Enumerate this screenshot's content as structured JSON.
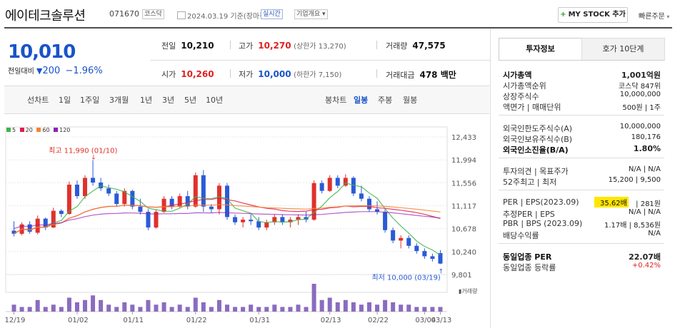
{
  "header": {
    "company": "에이테크솔루션",
    "code": "071670",
    "market_tag": "코스닥",
    "date_text": "2024.03.19 기준(장마감)",
    "realtime_tag": "실시간",
    "info_tag": "기업개요 ▾",
    "mystock_button": "MY STOCK 추가",
    "quick_order": "빠른주문"
  },
  "price": {
    "current": "10,010",
    "change_label": "전일대비",
    "change_value": "200",
    "change_pct": "−1.96%"
  },
  "stats": {
    "prev_label": "전일",
    "prev": "10,210",
    "high_label": "고가",
    "high": "10,270",
    "upper_limit": "(상한가 13,270)",
    "volume_label": "거래량",
    "volume": "47,575",
    "open_label": "시가",
    "open": "10,260",
    "low_label": "저가",
    "low": "10,000",
    "lower_limit": "(하한가 7,150)",
    "amount_label": "거래대금",
    "amount": "478 백만"
  },
  "range_tabs": {
    "line_chart": "선차트",
    "items": [
      "1일",
      "1주일",
      "3개월",
      "1년",
      "3년",
      "5년",
      "10년"
    ],
    "candle_chart": "봉차트",
    "periods": [
      "일봉",
      "주봉",
      "월봉"
    ],
    "selected_period": "일봉"
  },
  "chart_data": {
    "type": "candlestick",
    "legend": [
      {
        "label": "5",
        "color": "#3cb44b"
      },
      {
        "label": "20",
        "color": "#e6194b"
      },
      {
        "label": "60",
        "color": "#f58231"
      },
      {
        "label": "120",
        "color": "#911eb4"
      }
    ],
    "y_ticks": [
      "12,433",
      "11,994",
      "11,556",
      "11,117",
      "10,678",
      "10,240",
      "9,801"
    ],
    "ylim": [
      9801,
      12433
    ],
    "x_ticks": [
      "12/19",
      "01/02",
      "01/11",
      "01/22",
      "01/31",
      "02/13",
      "02/22",
      "03/04",
      "03/13"
    ],
    "annotations": {
      "high": "최고 11,990 (01/10)",
      "low": "최저 10,000 (03/19)"
    },
    "volume_label": "거래량",
    "candles": [
      [
        10640,
        10820,
        10530,
        10580
      ],
      [
        10580,
        10800,
        10550,
        10760
      ],
      [
        10760,
        10820,
        10580,
        10620
      ],
      [
        10600,
        10930,
        10570,
        10870
      ],
      [
        10870,
        10890,
        10650,
        10700
      ],
      [
        10700,
        11080,
        10690,
        11020
      ],
      [
        11020,
        11050,
        10900,
        10960
      ],
      [
        10960,
        11580,
        10940,
        11520
      ],
      [
        11520,
        11600,
        11250,
        11300
      ],
      [
        11300,
        11700,
        11250,
        11650
      ],
      [
        11650,
        11990,
        11500,
        11560
      ],
      [
        11560,
        11650,
        11400,
        11450
      ],
      [
        11450,
        11520,
        11300,
        11350
      ],
      [
        11350,
        11400,
        11100,
        11150
      ],
      [
        11150,
        11450,
        11100,
        11400
      ],
      [
        11400,
        11420,
        11050,
        11100
      ],
      [
        11100,
        11250,
        10950,
        11000
      ],
      [
        11000,
        11050,
        10650,
        10700
      ],
      [
        10700,
        11050,
        10680,
        11000
      ],
      [
        11000,
        11300,
        10980,
        11250
      ],
      [
        11250,
        11300,
        11050,
        11100
      ],
      [
        11100,
        11350,
        11080,
        11300
      ],
      [
        11300,
        11400,
        11050,
        11100
      ],
      [
        11100,
        11750,
        11080,
        11700
      ],
      [
        11700,
        11800,
        11000,
        11100
      ],
      [
        11100,
        11150,
        10980,
        11050
      ],
      [
        11050,
        11550,
        10950,
        11500
      ],
      [
        11500,
        11550,
        10850,
        10900
      ],
      [
        10900,
        10950,
        10750,
        10800
      ],
      [
        10800,
        10900,
        10700,
        10850
      ],
      [
        10850,
        10950,
        10750,
        10820
      ],
      [
        10820,
        10900,
        10650,
        10700
      ],
      [
        10700,
        10850,
        10650,
        10800
      ],
      [
        10800,
        10950,
        10750,
        10900
      ],
      [
        10900,
        10950,
        10750,
        10800
      ],
      [
        10800,
        10900,
        10700,
        10850
      ],
      [
        10850,
        10950,
        10750,
        10900
      ],
      [
        10900,
        11000,
        10800,
        10850
      ],
      [
        10850,
        11600,
        10830,
        11550
      ],
      [
        11550,
        11600,
        11350,
        11400
      ],
      [
        11400,
        11700,
        11380,
        11650
      ],
      [
        11650,
        11700,
        11450,
        11500
      ],
      [
        11500,
        11720,
        11480,
        11650
      ],
      [
        11650,
        11680,
        11300,
        11350
      ],
      [
        11350,
        11500,
        11200,
        11250
      ],
      [
        11250,
        11300,
        11000,
        11050
      ],
      [
        11050,
        11200,
        10950,
        11000
      ],
      [
        11000,
        11050,
        10600,
        10650
      ],
      [
        10650,
        10700,
        10400,
        10450
      ],
      [
        10450,
        10550,
        10300,
        10500
      ],
      [
        10500,
        10550,
        10300,
        10350
      ],
      [
        10350,
        10400,
        10200,
        10250
      ],
      [
        10250,
        10300,
        10100,
        10150
      ],
      [
        10150,
        10200,
        10050,
        10100
      ],
      [
        10210,
        10270,
        10000,
        10010
      ]
    ],
    "volumes": [
      3,
      2,
      2,
      5,
      2,
      3,
      2,
      6,
      4,
      5,
      7,
      5,
      3,
      2,
      4,
      3,
      2,
      5,
      3,
      4,
      2,
      3,
      2,
      6,
      4,
      2,
      5,
      3,
      2,
      2,
      3,
      2,
      2,
      3,
      2,
      2,
      3,
      2,
      12,
      5,
      6,
      4,
      5,
      4,
      3,
      4,
      3,
      5,
      4,
      3,
      3,
      2,
      2,
      2,
      2
    ]
  },
  "right_panel": {
    "tab_invest": "투자정보",
    "tab_quote": "호가 10단계",
    "rows1": [
      {
        "label": "시가총액",
        "value": "1,001억원",
        "bold": true
      },
      {
        "label": "시가총액순위",
        "value": "코스닥 847위"
      },
      {
        "label": "상장주식수",
        "value": "10,000,000"
      },
      {
        "label": "액면가 | 매매단위",
        "value": "500원 | 1주"
      }
    ],
    "rows2": [
      {
        "label": "외국인한도주식수(A)",
        "value": "10,000,000"
      },
      {
        "label": "외국인보유주식수(B)",
        "value": "180,176"
      },
      {
        "label": "외국인소진율(B/A)",
        "value": "1.80%",
        "bold": true
      }
    ],
    "rows3": [
      {
        "label": "투자의견 | 목표주가",
        "value": "N/A | N/A"
      },
      {
        "label": "52주최고 | 최저",
        "value": "15,200 | 9,500"
      }
    ],
    "per_row": {
      "label": "PER | EPS(2023.09)",
      "highlight": "35.62배",
      "value": "281원"
    },
    "rows4": [
      {
        "label": "추정PER | EPS",
        "value": "N/A | N/A"
      },
      {
        "label": "PBR | BPS (2023.09)",
        "value": "1.17배 | 8,536원"
      },
      {
        "label": "배당수익률",
        "value": "N/A"
      }
    ],
    "rows5": [
      {
        "label": "동일업종 PER",
        "value": "22.07배",
        "bold": true
      },
      {
        "label": "동일업종 등락률",
        "value": "+0.42%",
        "red": true
      }
    ]
  }
}
